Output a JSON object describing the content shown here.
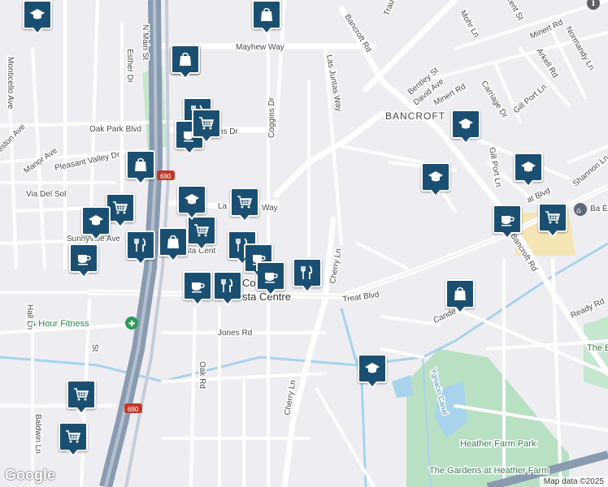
{
  "colors": {
    "background": "#eeeef2",
    "road": "#ffffff",
    "highway": "#8a9bb0",
    "water": "#a7d3ec",
    "park": "#b9e0c3",
    "school": "#f3e6b4",
    "pin": "#1b4f72"
  },
  "labels": {
    "mayhew": "Mayhew Way",
    "n_main": "N Main St",
    "oak_park": "Oak Park Blvd",
    "coggins_dr_left": "oggins Dr",
    "coggins_dr": "Coggins Dr",
    "pleasant_valley": "Pleasant Valley Dr",
    "manor": "Manor Ave",
    "preston": "reston Ave",
    "monticello": "Monticello Ave",
    "esther": "Esther Dr",
    "via_del_sol": "Via Del Sol",
    "sunnyvale": "Sunnyvale Ave",
    "la_way": "La",
    "way": "Way",
    "sta_cent": "sta Cent",
    "co": "Co",
    "sta_centre": "sta Centre",
    "treat_blvd": "Treat Blvd",
    "treat_blvd_right": "at Blvd",
    "jones": "Jones Rd",
    "hour_fitness": "24 Hour Fitness",
    "hall": "Hall Ln",
    "oak_rd": "Oak Rd",
    "baldwin": "Baldwin Ln",
    "st": "St",
    "cherry_ln": "Cherry Ln",
    "cherry_ln_lower": "Cherry Ln",
    "las_juntas": "Las Juntas Way",
    "traud": "Traud Dr",
    "bancroft_rd": "Bancroft Rd",
    "bancroft_area": "BANCROFT",
    "bancroft_rd_lower": "Bancroft Rd",
    "bentley": "Bentley St",
    "david": "David Ave",
    "minert_rd": "Minert Rd",
    "minert_rd_right": "Minert Rd",
    "mohr": "Mohr Ln",
    "rent_st": "rent St",
    "normandy": "Normandy Ln",
    "arkell": "Arkell Rd",
    "carriage": "Carriage Dr",
    "gill_port": "Gill Port Ln",
    "gill_port_vert": "Gill Port Ln",
    "shannon": "Shannon Ln",
    "ready": "Ready Rd",
    "cande": "Cande",
    "ygnacio": "Ygnacio Canal",
    "heather_farm": "Heather Farm Park",
    "gardens": "The Gardens at Heather Farm",
    "the_bay": "The Bar Garde Nur",
    "ba_ele": "Ba Ele",
    "hw680": "680"
  },
  "footer": {
    "google": "Google",
    "attribution": "Map data ©2025"
  },
  "pois": [
    {
      "icon": "school",
      "name": "school-marker"
    },
    {
      "icon": "shopping",
      "name": "shopping-marker"
    },
    {
      "icon": "shopping",
      "name": "shopping-marker"
    },
    {
      "icon": "restaurant",
      "name": "restaurant-marker"
    },
    {
      "icon": "cafe",
      "name": "cafe-marker"
    },
    {
      "icon": "shopping",
      "name": "shopping-marker"
    },
    {
      "icon": "school",
      "name": "school-marker"
    },
    {
      "icon": "grocery",
      "name": "grocery-marker"
    },
    {
      "icon": "grocery",
      "name": "grocery-marker"
    },
    {
      "icon": "school",
      "name": "school-marker"
    },
    {
      "icon": "grocery",
      "name": "grocery-marker"
    },
    {
      "icon": "restaurant",
      "name": "restaurant-marker"
    },
    {
      "icon": "shopping",
      "name": "shopping-marker"
    },
    {
      "icon": "restaurant",
      "name": "restaurant-marker"
    },
    {
      "icon": "cafe",
      "name": "cafe-marker"
    },
    {
      "icon": "cafe",
      "name": "cafe-marker"
    },
    {
      "icon": "restaurant",
      "name": "restaurant-marker"
    },
    {
      "icon": "cafe",
      "name": "cafe-marker"
    },
    {
      "icon": "cafe",
      "name": "cafe-marker"
    },
    {
      "icon": "restaurant",
      "name": "restaurant-marker"
    },
    {
      "icon": "school",
      "name": "school-marker"
    },
    {
      "icon": "shopping",
      "name": "shopping-marker"
    },
    {
      "icon": "school",
      "name": "school-marker"
    },
    {
      "icon": "cafe",
      "name": "cafe-marker"
    },
    {
      "icon": "grocery",
      "name": "grocery-marker"
    },
    {
      "icon": "shopping",
      "name": "shopping-marker"
    },
    {
      "icon": "school",
      "name": "school-marker"
    },
    {
      "icon": "grocery",
      "name": "grocery-marker"
    },
    {
      "icon": "grocery",
      "name": "grocery-marker"
    },
    {
      "icon": "grocery",
      "name": "grocery-marker"
    },
    {
      "icon": "school",
      "name": "school-marker"
    }
  ]
}
